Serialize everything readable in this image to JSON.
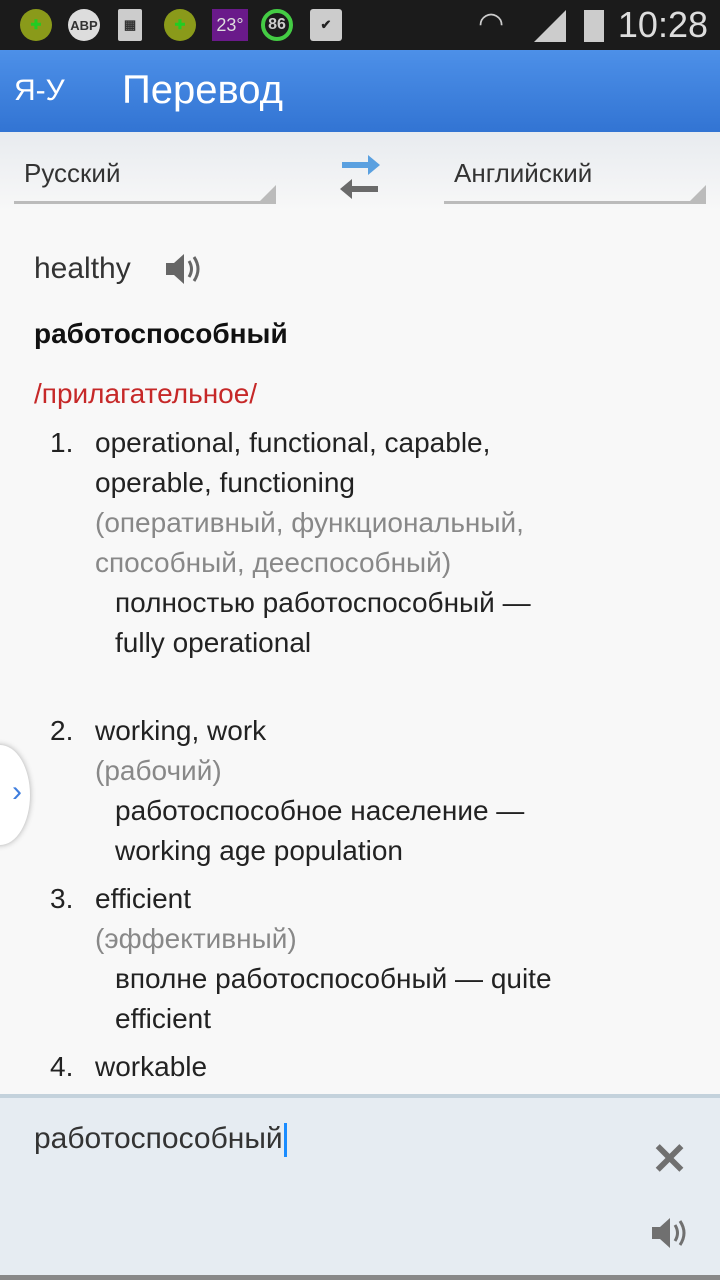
{
  "status_bar": {
    "time": "10:28",
    "icons": [
      "plus-app-icon",
      "abp-icon",
      "sim-icon",
      "plus-app-check-icon",
      "weather-icon",
      "battery-circle-icon",
      "shopping-bag-icon",
      "wifi-icon",
      "signal-icon",
      "battery-icon"
    ],
    "weather": "23°",
    "badge": "86",
    "abp": "ABP"
  },
  "app_bar": {
    "logo": "Я-У",
    "title": "Перевод"
  },
  "languages": {
    "source": "Русский",
    "target": "Английский"
  },
  "entry": {
    "word": "healthy",
    "translation": "работоспособный",
    "part_of_speech": "/прилагательное/",
    "senses": [
      {
        "num": "1.",
        "text": "operational, functional, capable, operable, functioning",
        "gloss": "(оперативный, функциональный, способный, дееспособный)",
        "example": "полностью работоспособный — fully operational"
      },
      {
        "num": "2.",
        "text": "working, work",
        "gloss": "(рабочий)",
        "example": "работоспособное население — working age population"
      },
      {
        "num": "3.",
        "text": "efficient",
        "gloss": "(эффективный)",
        "example": "вполне работоспособный — quite efficient"
      },
      {
        "num": "4.",
        "text": "workable",
        "gloss": "",
        "example": ""
      }
    ]
  },
  "input": {
    "value": "работоспособный"
  },
  "colors": {
    "accent": "#3c7fdc",
    "part_of_speech": "#c62828",
    "caret": "#1a8cff"
  }
}
